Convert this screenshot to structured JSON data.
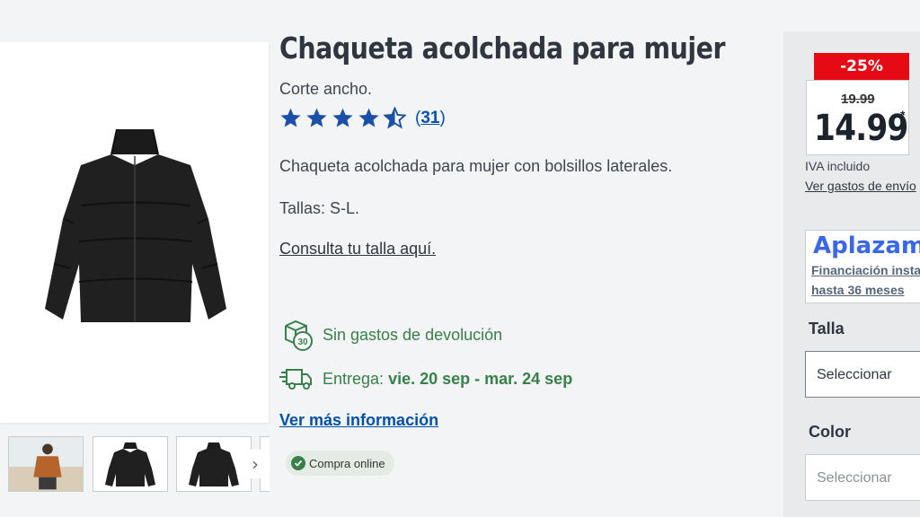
{
  "product": {
    "title": "Chaqueta acolchada para mujer",
    "subtitle": "Corte ancho.",
    "rating": {
      "stars": 4.5,
      "max": 5,
      "count_text": "31",
      "open": "(",
      "close": ")"
    },
    "description": "Chaqueta acolchada para mujer con bolsillos laterales.",
    "sizes": "Tallas: S-L.",
    "size_guide_link": "Consulta tu talla aquí.",
    "returns_text": "Sin gastos de devolución",
    "returns_icon_label": "30",
    "delivery_label": "Entrega: ",
    "delivery_dates": "vie. 20 sep - mar. 24 sep",
    "more_info_link": "Ver más información",
    "online_badge": "Compra online"
  },
  "gallery": {
    "thumbnails": [
      "model-photo",
      "jacket-front",
      "jacket-back",
      "partial"
    ],
    "next_icon": "›"
  },
  "price": {
    "discount": "-25%",
    "old_price": "19.99",
    "new_price": "14.99",
    "asterisk": "*",
    "vat_text": "IVA incluido",
    "shipping_link": "Ver gastos de envío"
  },
  "financing": {
    "logo": "Aplazame",
    "line1": "Financiación instantánea",
    "line2": "hasta 36 meses"
  },
  "options": {
    "size_label": "Talla",
    "size_placeholder": "Seleccionar",
    "color_label": "Color",
    "color_placeholder": "Seleccionar"
  },
  "colors": {
    "accent_blue": "#0050aa",
    "green": "#37804a",
    "discount_red": "#e60a14",
    "aplazame_blue": "#3a67e8"
  }
}
